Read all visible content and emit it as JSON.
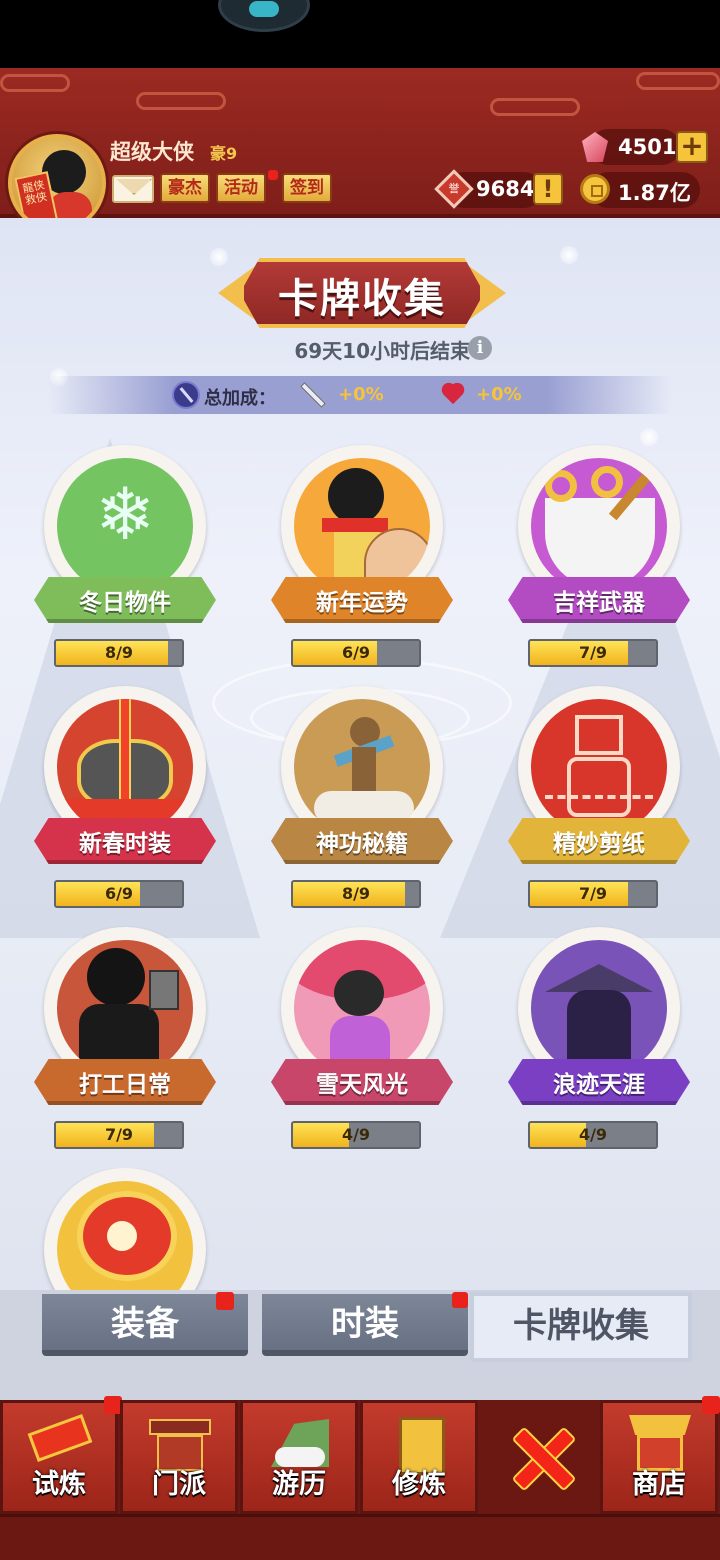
{
  "header": {
    "player_name": "超级大侠",
    "vip_level": "豪9",
    "avatar_scroll_text": "龍侠救侠",
    "tags": [
      "豪杰",
      "活动",
      "签到"
    ],
    "resources": {
      "gems": "4501",
      "honor": "9684",
      "honor_badge": "誉",
      "coins": "1.87亿"
    }
  },
  "page": {
    "title": "卡牌收集",
    "countdown": "69天10小时后结束",
    "info_glyph": "i",
    "bonus_label": "总加成：",
    "attack_bonus": "+0%",
    "hp_bonus": "+0%"
  },
  "cards": [
    {
      "name": "冬日物件",
      "progress": "8/9",
      "fraction": 0.889,
      "ribbon_color": "#7fbd5a",
      "art_bg": "#74c461"
    },
    {
      "name": "新年运势",
      "progress": "6/9",
      "fraction": 0.667,
      "ribbon_color": "#e0842a",
      "art_bg": "#f6a93a"
    },
    {
      "name": "吉祥武器",
      "progress": "7/9",
      "fraction": 0.778,
      "ribbon_color": "#b34cc2",
      "art_bg": "#c65ad3"
    },
    {
      "name": "新春时装",
      "progress": "6/9",
      "fraction": 0.667,
      "ribbon_color": "#d5334b",
      "art_bg": "#d4442e"
    },
    {
      "name": "神功秘籍",
      "progress": "8/9",
      "fraction": 0.889,
      "ribbon_color": "#b98644",
      "art_bg": "#c99b55"
    },
    {
      "name": "精妙剪纸",
      "progress": "7/9",
      "fraction": 0.778,
      "ribbon_color": "#e2b43a",
      "art_bg": "#d9362b"
    },
    {
      "name": "打工日常",
      "progress": "7/9",
      "fraction": 0.778,
      "ribbon_color": "#c86a2e",
      "art_bg": "#c8563a"
    },
    {
      "name": "雪天风光",
      "progress": "4/9",
      "fraction": 0.444,
      "ribbon_color": "#c8466a",
      "art_bg": "#f09ab7"
    },
    {
      "name": "浪迹天涯",
      "progress": "4/9",
      "fraction": 0.444,
      "ribbon_color": "#7b3fc4",
      "art_bg": "#7a53b8"
    },
    {
      "name": "",
      "progress": "",
      "fraction": 0,
      "ribbon_color": "#d5334b",
      "art_bg": "#f2c23f"
    }
  ],
  "sub_tabs": [
    {
      "label": "装备",
      "active": false,
      "badge": true
    },
    {
      "label": "时装",
      "active": false,
      "badge": true
    },
    {
      "label": "卡牌收集",
      "active": true,
      "badge": false
    }
  ],
  "nav": [
    {
      "label": "试炼",
      "icon": "scroll-icon",
      "badge": true
    },
    {
      "label": "门派",
      "icon": "gate-icon",
      "badge": false
    },
    {
      "label": "游历",
      "icon": "mountain-icon",
      "badge": false
    },
    {
      "label": "修炼",
      "icon": "book-icon",
      "badge": false
    },
    {
      "label": "",
      "icon": "close-icon",
      "badge": false
    },
    {
      "label": "商店",
      "icon": "shop-icon",
      "badge": true
    }
  ],
  "colors": {
    "header_red": "#8f231d",
    "gold": "#f2bf4c",
    "progress_fill": "#f0b31d"
  }
}
